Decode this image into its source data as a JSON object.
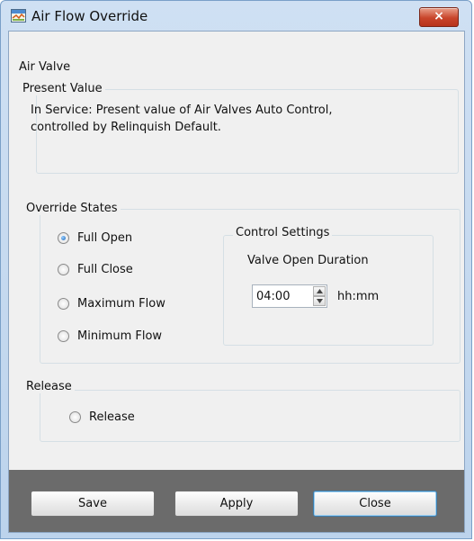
{
  "window": {
    "title": "Air Flow Override",
    "close_label": "×"
  },
  "header": {
    "section_label": "Air Valve"
  },
  "present_value": {
    "legend": "Present Value",
    "line1": "In Service: Present value of Air Valves Auto Control,",
    "line2": "controlled by Relinquish Default."
  },
  "override_states": {
    "legend": "Override States",
    "options": [
      {
        "label": "Full Open",
        "checked": true
      },
      {
        "label": "Full Close",
        "checked": false
      },
      {
        "label": "Maximum Flow",
        "checked": false
      },
      {
        "label": "Minimum Flow",
        "checked": false
      }
    ]
  },
  "control_settings": {
    "legend": "Control Settings",
    "field_label": "Valve Open Duration",
    "value": "04:00",
    "unit": "hh:mm"
  },
  "release": {
    "legend": "Release",
    "option_label": "Release",
    "checked": false
  },
  "buttons": {
    "save": "Save",
    "apply": "Apply",
    "close": "Close"
  },
  "colors": {
    "footer": "#6b6b6b",
    "close_button": "#c8452b",
    "frame": "#cfe0f3"
  }
}
